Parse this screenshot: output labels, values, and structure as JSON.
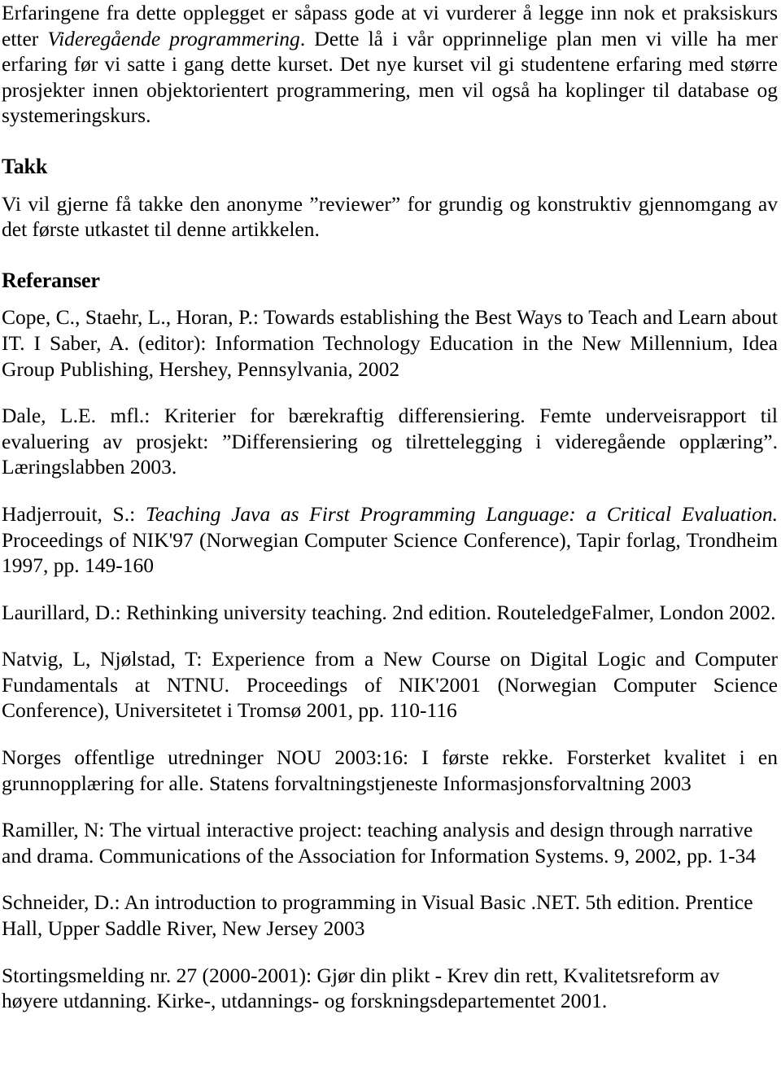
{
  "document": {
    "language": "no",
    "text_color": "#000000",
    "background_color": "#ffffff"
  },
  "intro_paragraph": {
    "part1": "Erfaringene fra dette opplegget er såpass gode at vi vurderer å legge inn nok et praksiskurs etter ",
    "emphasis": "Videregående programmering",
    "part2": ". Dette lå i vår opprinnelige plan men vi ville ha mer erfaring før vi satte i gang dette kurset. Det nye kurset vil gi studentene erfaring med større prosjekter innen objektorientert programmering, men vil også ha koplinger til database og systemeringskurs."
  },
  "acknowledgements": {
    "heading": "Takk",
    "body": "Vi vil gjerne få takke den anonyme ”reviewer” for grundig og konstruktiv gjennomgang av det første utkastet til denne artikkelen."
  },
  "references": {
    "heading": "Referanser",
    "items": [
      {
        "id": "cope",
        "text": "Cope, C., Staehr, L., Horan, P.:  Towards establishing the Best Ways to Teach and Learn about IT.  I Saber, A. (editor):  Information Technology Education in the New Millennium,  Idea Group Publishing, Hershey, Pennsylvania, 2002",
        "italic_part": "",
        "justified": true
      },
      {
        "id": "dale",
        "text": "Dale, L.E. mfl.: Kriterier for bærekraftig differensiering.  Femte underveisrapport til evaluering av prosjekt: ”Differensiering og tilrettelegging i videregående opplæring”. Læringslabben 2003.",
        "italic_part": "",
        "justified": true
      },
      {
        "id": "hadjerrouit",
        "prefix": "Hadjerrouit, S.: ",
        "italic_part": "Teaching Java as First Programming Language: a Critical Evaluation.",
        "suffix": " Proceedings of NIK'97 (Norwegian Computer Science Conference), Tapir forlag, Trondheim 1997, pp. 149-160",
        "justified": true
      },
      {
        "id": "laurillard",
        "text": "Laurillard, D.:  Rethinking university teaching.  2nd edition.  RouteledgeFalmer, London 2002.",
        "italic_part": "",
        "justified": false
      },
      {
        "id": "natvig",
        "text": "Natvig, L, Njølstad, T: Experience from a New Course on Digital Logic and Computer Fundamentals at NTNU.   Proceedings of NIK'2001 (Norwegian Computer Science Conference), Universitetet i Tromsø 2001, pp. 110-116",
        "italic_part": "",
        "justified": true
      },
      {
        "id": "nou",
        "text": "Norges offentlige utredninger NOU 2003:16: I første rekke.  Forsterket kvalitet i en grunnopplæring for alle.  Statens forvaltningstjeneste Informasjonsforvaltning 2003",
        "italic_part": "",
        "justified": true
      },
      {
        "id": "ramiller",
        "text": "Ramiller, N: The virtual interactive project: teaching analysis and design through narrative and drama. Communications of the Association for Information Systems. 9, 2002, pp. 1-34",
        "italic_part": "",
        "justified": false
      },
      {
        "id": "schneider",
        "text": "Schneider, D.:  An introduction to programming in Visual Basic .NET. 5th edition. Prentice Hall, Upper Saddle River, New Jersey 2003",
        "italic_part": "",
        "justified": false
      },
      {
        "id": "stortingsmelding",
        "text": "Stortingsmelding nr. 27 (2000-2001): Gjør din plikt - Krev din rett, Kvalitetsreform av høyere utdanning.  Kirke-, utdannings- og forskningsdepartementet 2001.",
        "justified": false
      }
    ]
  }
}
